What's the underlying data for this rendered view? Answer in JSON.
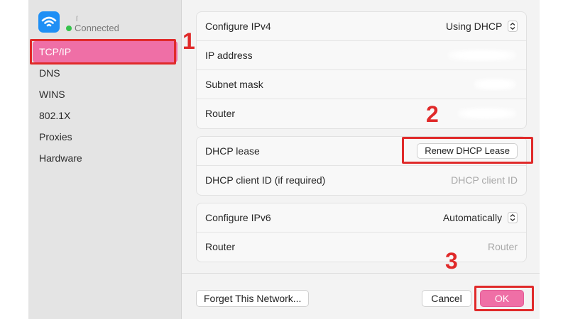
{
  "sidebar": {
    "status_text": "Connected",
    "status_color": "#35c24b",
    "wifi_icon": "wifi-icon",
    "items": [
      {
        "label": "TCP/IP",
        "selected": true
      },
      {
        "label": "DNS"
      },
      {
        "label": "WINS"
      },
      {
        "label": "802.1X"
      },
      {
        "label": "Proxies"
      },
      {
        "label": "Hardware"
      }
    ]
  },
  "ipv4": {
    "configure_label": "Configure IPv4",
    "configure_value": "Using DHCP",
    "ip_label": "IP address",
    "subnet_label": "Subnet mask",
    "router_label": "Router"
  },
  "dhcp": {
    "lease_label": "DHCP lease",
    "renew_button": "Renew DHCP Lease",
    "client_id_label": "DHCP client ID (if required)",
    "client_id_placeholder": "DHCP client ID"
  },
  "ipv6": {
    "configure_label": "Configure IPv6",
    "configure_value": "Automatically",
    "router_label": "Router",
    "router_placeholder": "Router"
  },
  "footer": {
    "forget_button": "Forget This Network...",
    "cancel_button": "Cancel",
    "ok_button": "OK"
  },
  "annotations": {
    "step1": "1",
    "step2": "2",
    "step3": "3",
    "highlight_color": "#e02a2a"
  },
  "theme": {
    "accent": "#ef6fa6",
    "wifi_blue": "#1f8ff5"
  }
}
